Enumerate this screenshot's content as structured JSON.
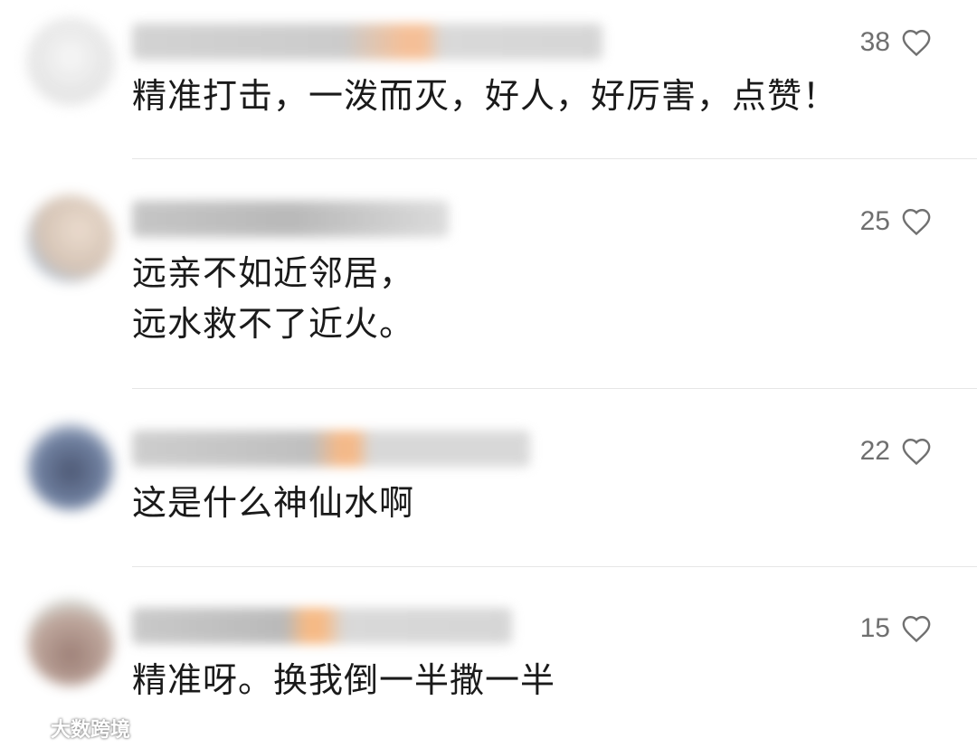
{
  "comments": [
    {
      "likes": "38",
      "text": "精准打击，一泼而灭，好人，好厉害，点赞！",
      "avatar_colors": [
        "#f0f0f0",
        "#dcdcdc"
      ],
      "username_colors": [
        "#c8c8c8",
        "#f3b07e",
        "#d0d0d0"
      ]
    },
    {
      "likes": "25",
      "text": "远亲不如近邻居，\n远水救不了近火。",
      "avatar_colors": [
        "#d9c7b8",
        "#9bb5cf"
      ],
      "username_colors": [
        "#b5b5b5",
        "#c9c9c9",
        "#d3d3d3"
      ]
    },
    {
      "likes": "22",
      "text": "这是什么神仙水啊",
      "avatar_colors": [
        "#2e3b5c",
        "#9aa8c2"
      ],
      "username_colors": [
        "#c0c0c0",
        "#f2a86c",
        "#d1d1d1"
      ]
    },
    {
      "likes": "15",
      "text": "精准呀。换我倒一半撒一半",
      "avatar_colors": [
        "#8d6a60",
        "#c9d6cf"
      ],
      "username_colors": [
        "#bdbdbd",
        "#f4a968",
        "#d0d0d0"
      ]
    }
  ],
  "watermark": {
    "text": "大数跨境"
  }
}
